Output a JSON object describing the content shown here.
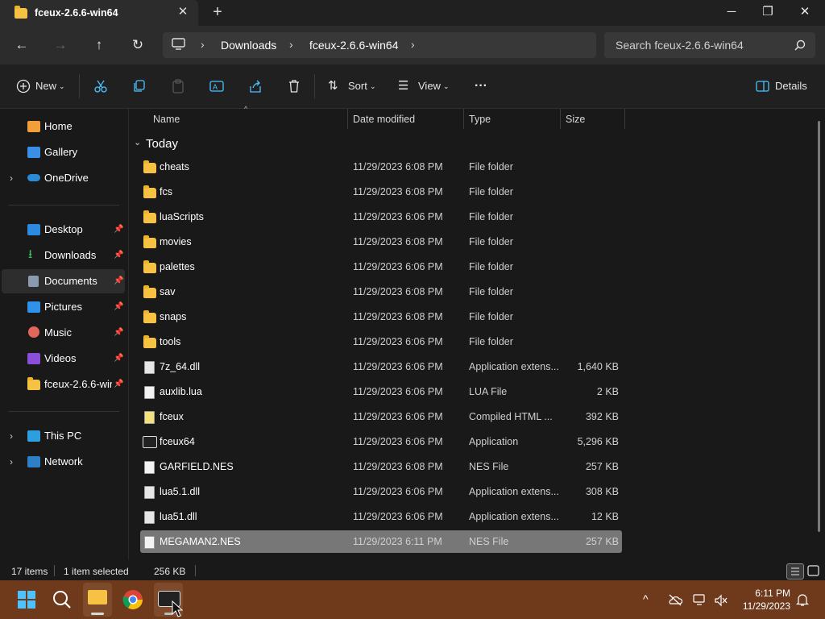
{
  "window": {
    "tab_title": "fceux-2.6.6-win64",
    "tab_close": "✕",
    "new_tab": "+",
    "minimize": "─",
    "maximize": "❐",
    "close": "✕"
  },
  "address": {
    "back": "←",
    "forward": "→",
    "up": "↑",
    "refresh": "↻",
    "breadcrumbs": [
      "Downloads",
      "fceux-2.6.6-win64"
    ],
    "separator": "›",
    "search_placeholder": "Search fceux-2.6.6-win64"
  },
  "commands": {
    "new_label": "New",
    "sort_label": "Sort",
    "view_label": "View",
    "more_label": "···",
    "details_label": "Details"
  },
  "nav": {
    "home": "Home",
    "gallery": "Gallery",
    "onedrive": "OneDrive",
    "desktop": "Desktop",
    "downloads": "Downloads",
    "documents": "Documents",
    "pictures": "Pictures",
    "music": "Music",
    "videos": "Videos",
    "fceux_folder": "fceux-2.6.6-win64",
    "this_pc": "This PC",
    "network": "Network"
  },
  "columns": {
    "name": "Name",
    "date_modified": "Date modified",
    "type": "Type",
    "size": "Size"
  },
  "group_label": "Today",
  "files": [
    {
      "name": "cheats",
      "date": "11/29/2023 6:08 PM",
      "type": "File folder",
      "size": "",
      "icon": "folder-icon"
    },
    {
      "name": "fcs",
      "date": "11/29/2023 6:08 PM",
      "type": "File folder",
      "size": "",
      "icon": "folder-icon"
    },
    {
      "name": "luaScripts",
      "date": "11/29/2023 6:06 PM",
      "type": "File folder",
      "size": "",
      "icon": "folder-icon"
    },
    {
      "name": "movies",
      "date": "11/29/2023 6:08 PM",
      "type": "File folder",
      "size": "",
      "icon": "folder-icon"
    },
    {
      "name": "palettes",
      "date": "11/29/2023 6:06 PM",
      "type": "File folder",
      "size": "",
      "icon": "folder-icon"
    },
    {
      "name": "sav",
      "date": "11/29/2023 6:08 PM",
      "type": "File folder",
      "size": "",
      "icon": "folder-icon"
    },
    {
      "name": "snaps",
      "date": "11/29/2023 6:08 PM",
      "type": "File folder",
      "size": "",
      "icon": "folder-icon"
    },
    {
      "name": "tools",
      "date": "11/29/2023 6:06 PM",
      "type": "File folder",
      "size": "",
      "icon": "folder-icon"
    },
    {
      "name": "7z_64.dll",
      "date": "11/29/2023 6:06 PM",
      "type": "Application extens...",
      "size": "1,640 KB",
      "icon": "dll-file-icon"
    },
    {
      "name": "auxlib.lua",
      "date": "11/29/2023 6:06 PM",
      "type": "LUA File",
      "size": "2 KB",
      "icon": "file-icon"
    },
    {
      "name": "fceux",
      "date": "11/29/2023 6:06 PM",
      "type": "Compiled HTML ...",
      "size": "392 KB",
      "icon": "help-file-icon"
    },
    {
      "name": "fceux64",
      "date": "11/29/2023 6:06 PM",
      "type": "Application",
      "size": "5,296 KB",
      "icon": "fceux-app-icon"
    },
    {
      "name": "GARFIELD.NES",
      "date": "11/29/2023 6:08 PM",
      "type": "NES File",
      "size": "257 KB",
      "icon": "file-icon"
    },
    {
      "name": "lua5.1.dll",
      "date": "11/29/2023 6:06 PM",
      "type": "Application extens...",
      "size": "308 KB",
      "icon": "dll-file-icon"
    },
    {
      "name": "lua51.dll",
      "date": "11/29/2023 6:06 PM",
      "type": "Application extens...",
      "size": "12 KB",
      "icon": "dll-file-icon"
    },
    {
      "name": "MEGAMAN2.NES",
      "date": "11/29/2023 6:11 PM",
      "type": "NES File",
      "size": "257 KB",
      "icon": "file-icon",
      "selected": true
    }
  ],
  "status": {
    "item_count": "17 items",
    "selection": "1 item selected",
    "selection_size": "256 KB"
  },
  "taskbar": {
    "time": "6:11 PM",
    "date": "11/29/2023",
    "overflow": "^"
  },
  "colors": {
    "taskbar": "#6f3a1c",
    "selected_row": "#777777",
    "folder": "#f7c244",
    "accent": "#4cc2ff"
  }
}
